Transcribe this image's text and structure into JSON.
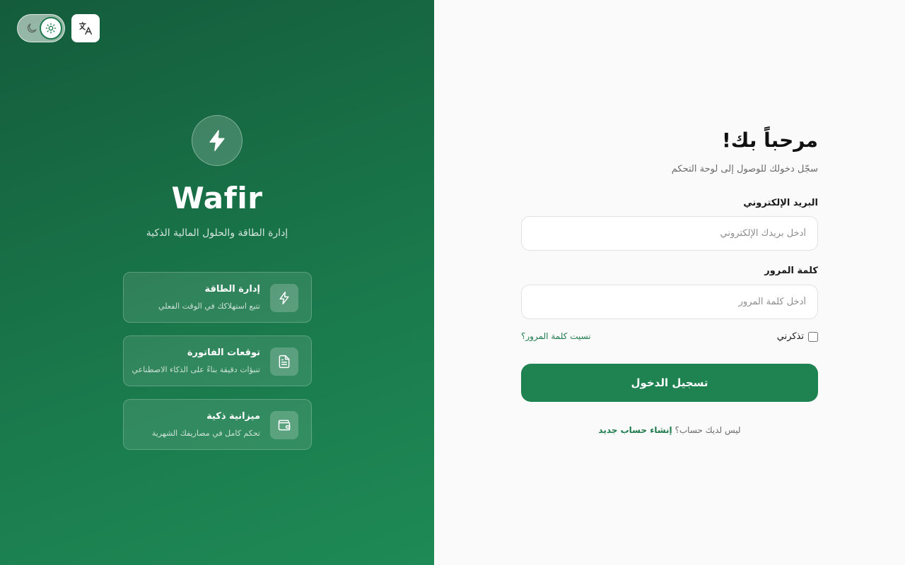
{
  "brand": {
    "name": "Wafir",
    "tagline": "إدارة الطاقة والحلول المالية الذكية",
    "features": [
      {
        "title": "إدارة الطاقة",
        "description": "تتبع استهلاكك في الوقت الفعلي",
        "icon": "zap-icon"
      },
      {
        "title": "توقعات الفاتورة",
        "description": "تنبؤات دقيقة بناءً على الذكاء الاصطناعي",
        "icon": "file-text-icon"
      },
      {
        "title": "ميزانية ذكية",
        "description": "تحكم كامل في مصاريفك الشهرية",
        "icon": "wallet-icon"
      }
    ]
  },
  "controls": {
    "theme": "light",
    "theme_icons": [
      "moon-icon",
      "sun-icon"
    ],
    "language_icon": "translate-icon"
  },
  "login": {
    "title": "مرحباً بك!",
    "subtitle": "سجّل دخولك للوصول إلى لوحة التحكم",
    "email_label": "البريد الإلكتروني",
    "email_placeholder": "أدخل بريدك الإلكتروني",
    "email_value": "",
    "password_label": "كلمة المرور",
    "password_placeholder": "أدخل كلمة المرور",
    "password_value": "",
    "remember_label": "تذكرني",
    "remember_checked": false,
    "forgot_link": "نسيت كلمة المرور؟",
    "submit_label": "تسجيل الدخول",
    "no_account_text": "ليس لديك حساب؟",
    "signup_link": "إنشاء حساب جديد"
  },
  "colors": {
    "brand_green": "#1e8251",
    "brand_dark_green": "#145c3c",
    "link_green": "#1d7a4c"
  }
}
